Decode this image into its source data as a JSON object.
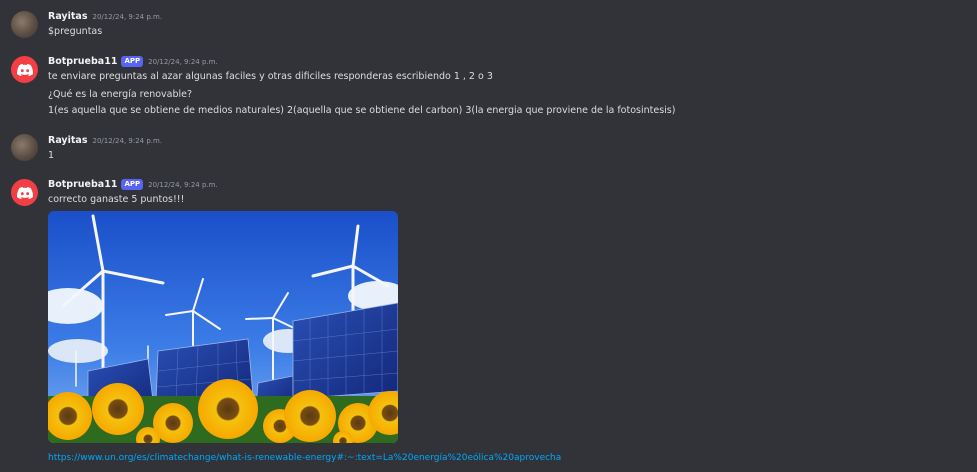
{
  "messages": [
    {
      "author": "Rayitas",
      "timestamp": "20/12/24, 9:24 p.m.",
      "lines": [
        "$preguntas"
      ]
    },
    {
      "author": "Botprueba11",
      "tag": "APP",
      "timestamp": "20/12/24, 9:24 p.m.",
      "lines": [
        "te enviare preguntas al azar algunas faciles y otras dificiles responderas escribiendo 1 , 2  o 3",
        "¿Qué es la energía renovable?",
        "1(es aquella que se obtiene de medios naturales) 2(aquella que se obtiene del carbon) 3(la energia que proviene de la fotosintesis)"
      ]
    },
    {
      "author": "Rayitas",
      "timestamp": "20/12/24, 9:24 p.m.",
      "lines": [
        "1"
      ]
    },
    {
      "author": "Botprueba11",
      "tag": "APP",
      "timestamp": "20/12/24, 9:24 p.m.",
      "lines": [
        "correcto ganaste 5 puntos!!!"
      ],
      "link": "https://www.un.org/es/climatechange/what-is-renewable-energy#:~:text=La%20energía%20eólica%20aprovecha"
    }
  ],
  "colors": {
    "background": "#313338",
    "bot_avatar": "#f23f43",
    "app_tag": "#5865f2",
    "link": "#00a8fc"
  }
}
